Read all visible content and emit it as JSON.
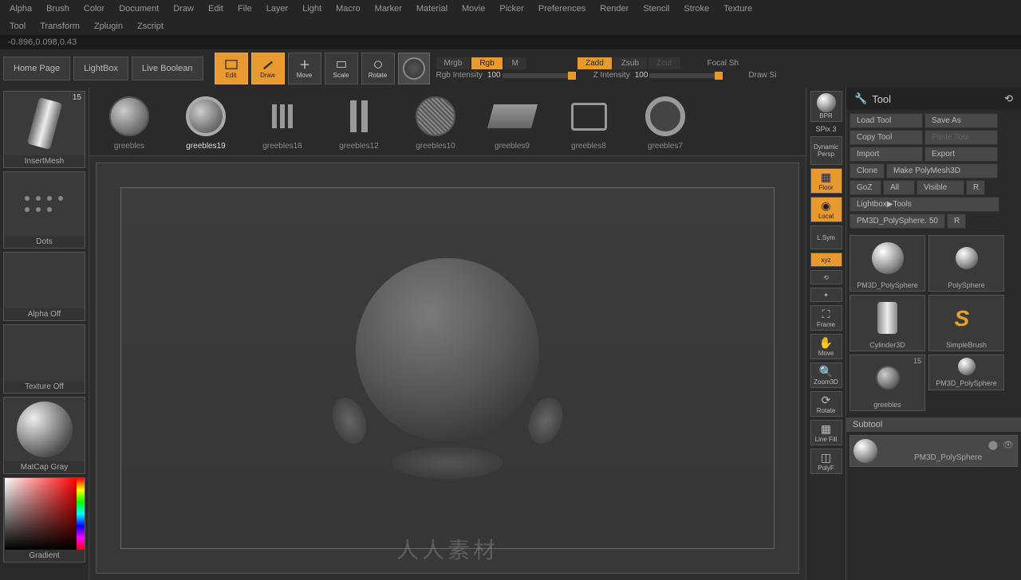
{
  "menu": {
    "row1": [
      "Alpha",
      "Brush",
      "Color",
      "Document",
      "Draw",
      "Edit",
      "File",
      "Layer",
      "Light",
      "Macro",
      "Marker",
      "Material",
      "Movie",
      "Picker",
      "Preferences",
      "Render",
      "Stencil",
      "Stroke",
      "Texture"
    ],
    "row2": [
      "Tool",
      "Transform",
      "Zplugin",
      "Zscript"
    ]
  },
  "coords": "-0.896,0.098,0.43",
  "toolbar": {
    "buttons": [
      "Home Page",
      "LightBox",
      "Live Boolean"
    ],
    "icons": [
      {
        "label": "Edit",
        "active": true
      },
      {
        "label": "Draw",
        "active": true
      },
      {
        "label": "Move",
        "active": false
      },
      {
        "label": "Scale",
        "active": false
      },
      {
        "label": "Rotate",
        "active": false
      }
    ],
    "modes1": [
      {
        "label": "Mrgb",
        "active": false
      },
      {
        "label": "Rgb",
        "active": true
      },
      {
        "label": "M",
        "active": false
      }
    ],
    "modes2": [
      {
        "label": "Zadd",
        "active": true
      },
      {
        "label": "Zsub",
        "active": false
      },
      {
        "label": "Zcut",
        "active": false
      }
    ],
    "rgb_label": "Rgb Intensity",
    "rgb_val": "100",
    "z_label": "Z Intensity",
    "z_val": "100",
    "focal": "Focal Sh",
    "draw": "Draw Si"
  },
  "left": {
    "brush": {
      "label": "InsertMesh",
      "badge": "15"
    },
    "stroke": {
      "label": "Dots"
    },
    "alpha": {
      "label": "Alpha Off"
    },
    "texture": {
      "label": "Texture Off"
    },
    "material": {
      "label": "MatCap Gray"
    },
    "gradient": {
      "label": "Gradient"
    }
  },
  "greebles": [
    "greebles",
    "greebles19",
    "greebles18",
    "greebles12",
    "greebles10",
    "greebles9",
    "greebles8",
    "greebles7"
  ],
  "rightTools": {
    "bpr": "BPR",
    "spix": "SPix 3",
    "dynamic": "Dynamic",
    "persp": "Persp",
    "floor": "Floor",
    "local": "Local",
    "lsym": "L.Sym",
    "xyz": "xyz",
    "frame": "Frame",
    "move": "Move",
    "zoom": "Zoom3D",
    "rotate": "Rotate",
    "linefill": "Line Fill",
    "polyf": "PolyF"
  },
  "toolPanel": {
    "title": "Tool",
    "buttons": [
      {
        "l": "Load Tool",
        "dim": false
      },
      {
        "l": "Save As",
        "dim": false
      },
      {
        "l": "Copy Tool",
        "dim": false
      },
      {
        "l": "Paste Tool",
        "dim": true
      },
      {
        "l": "Import",
        "dim": false
      },
      {
        "l": "Export",
        "dim": false
      },
      {
        "l": "Clone",
        "dim": false
      },
      {
        "l": "Make PolyMesh3D",
        "dim": false
      },
      {
        "l": "GoZ",
        "dim": false
      },
      {
        "l": "All",
        "dim": false
      },
      {
        "l": "Visible",
        "dim": false
      },
      {
        "l": "R",
        "dim": false
      }
    ],
    "lightbox": "Lightbox▶Tools",
    "info": {
      "name": "PM3D_PolySphere.",
      "val": "50",
      "r": "R"
    },
    "tools": [
      {
        "label": "PM3D_PolySphere",
        "type": "sphere",
        "badge": ""
      },
      {
        "label": "PolySphere",
        "type": "sphere",
        "badge": ""
      },
      {
        "label": "Cylinder3D",
        "type": "cyl",
        "badge": ""
      },
      {
        "label": "SimpleBrush",
        "type": "s",
        "badge": ""
      },
      {
        "label": "greebles",
        "type": "disc",
        "badge": "15"
      },
      {
        "label": "PM3D_PolySphere",
        "type": "sphere2",
        "badge": ""
      }
    ],
    "subtool": {
      "header": "Subtool",
      "item": "PM3D_PolySphere"
    }
  },
  "watermark": "人人素材"
}
